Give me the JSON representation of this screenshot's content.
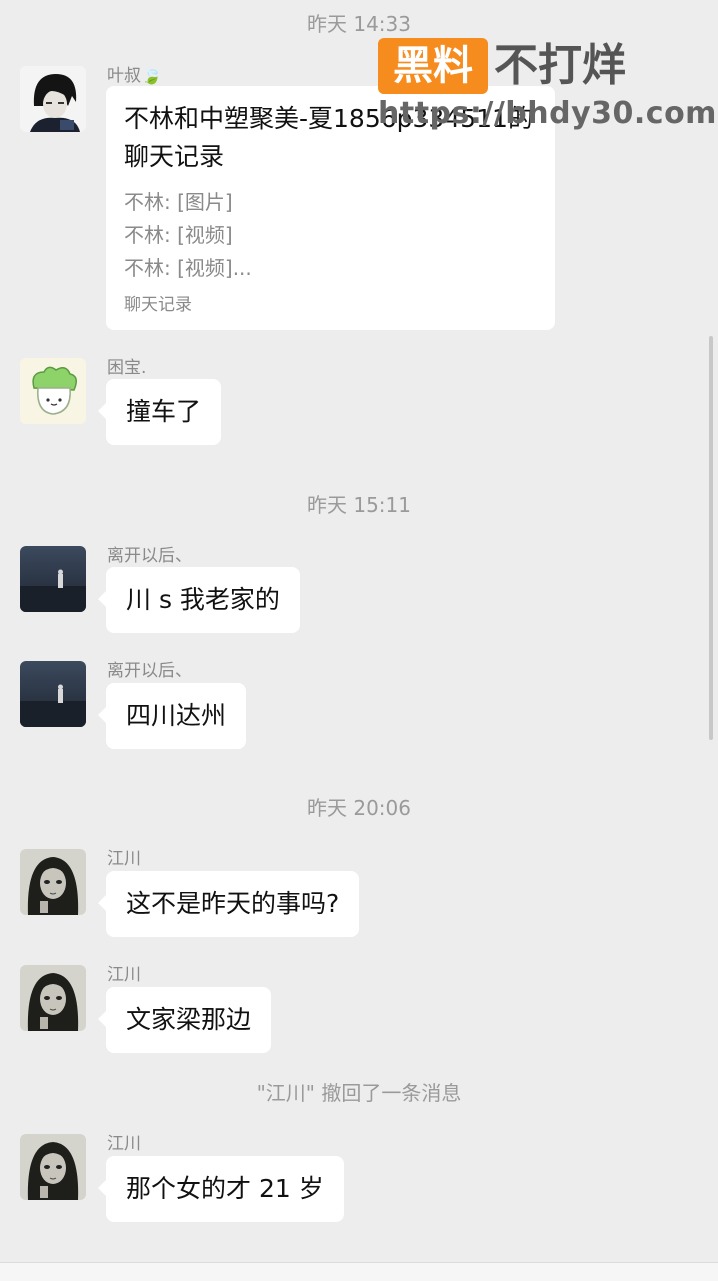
{
  "watermark": {
    "brand_box": "黑料",
    "brand_text": "不打烊",
    "url": "https://bhdy30.com"
  },
  "messages": [
    {
      "type": "timestamp",
      "text": "昨天 14:33"
    },
    {
      "type": "card",
      "sender": "叶叔🍃",
      "title": "不林和中塑聚美-夏1856p334511的聊天记录",
      "lines": [
        "不林: [图片]",
        "不林: [视频]",
        "不林: [视频]..."
      ],
      "footer": "聊天记录"
    },
    {
      "type": "text",
      "sender": "困宝.",
      "text": "撞车了"
    },
    {
      "type": "timestamp",
      "text": "昨天 15:11"
    },
    {
      "type": "text",
      "sender": "离开以后、",
      "text": "川 s  我老家的"
    },
    {
      "type": "text",
      "sender": "离开以后、",
      "text": "四川达州"
    },
    {
      "type": "timestamp",
      "text": "昨天 20:06"
    },
    {
      "type": "text",
      "sender": "江川",
      "text": "这不是昨天的事吗?"
    },
    {
      "type": "text",
      "sender": "江川",
      "text": "文家梁那边"
    },
    {
      "type": "system",
      "text": "\"江川\" 撤回了一条消息"
    },
    {
      "type": "text",
      "sender": "江川",
      "text": "那个女的才 21 岁"
    }
  ],
  "avatar_icons": [
    "dark-anime-avatar-icon",
    "cabbage-avatar-icon",
    "seaside-figure-avatar-icon",
    "long-hair-girl-avatar-icon"
  ]
}
